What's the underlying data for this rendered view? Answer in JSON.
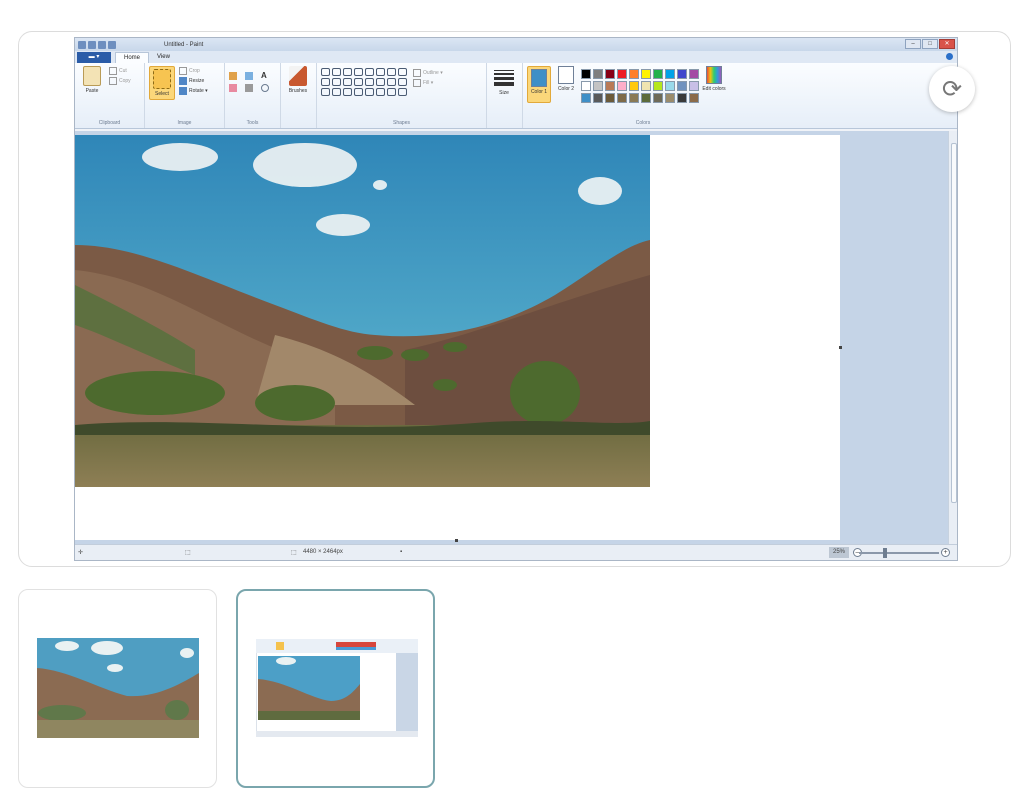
{
  "viewer": {
    "refresh_icon": "refresh-icon",
    "refresh_glyph": "⟳"
  },
  "paint": {
    "window_title": "Untitled - Paint",
    "file_button": "▬ ▾",
    "tabs": [
      {
        "label": "Home",
        "active": true
      },
      {
        "label": "View",
        "active": false
      }
    ],
    "window_controls": {
      "minimize": "–",
      "maximize": "□",
      "close": "✕"
    },
    "ribbon": {
      "clipboard": {
        "label": "Clipboard",
        "paste": "Paste",
        "cut": "Cut",
        "copy": "Copy"
      },
      "image": {
        "label": "Image",
        "select": "Select",
        "crop": "Crop",
        "resize": "Resize",
        "rotate": "Rotate ▾"
      },
      "tools": {
        "label": "Tools"
      },
      "brushes": {
        "label": "Brushes"
      },
      "shapes": {
        "label": "Shapes",
        "outline": "Outline ▾",
        "fill": "Fill ▾"
      },
      "size": {
        "label": "Size"
      },
      "colors": {
        "label": "Colors",
        "color1": "Color 1",
        "color2": "Color 2",
        "edit_colors": "Edit colors",
        "color1_value": "#3e8fc7",
        "color2_value": "#ffffff",
        "palette": [
          "#000000",
          "#7f7f7f",
          "#880015",
          "#ed1c24",
          "#ff7f27",
          "#fff200",
          "#22b14c",
          "#00a2e8",
          "#3f48cc",
          "#a349a4",
          "#ffffff",
          "#c3c3c3",
          "#b97a57",
          "#ffaec9",
          "#ffc90e",
          "#efe4b0",
          "#b5e61d",
          "#99d9ea",
          "#7092be",
          "#c8bfe7",
          "#3e8fc7",
          "#5a5a5a",
          "#6b5a3a",
          "#7d6a48",
          "#8a7a55",
          "#5c6b3c",
          "#6e6a58",
          "#9a8b6c",
          "#3a3a3a",
          "#8b6b4a"
        ]
      }
    },
    "status": {
      "canvas_size": "4480 × 2464px",
      "zoom": "25%",
      "zoom_minus": "–",
      "zoom_plus": "+"
    }
  },
  "thumbnails": [
    {
      "label": "landscape painting",
      "selected": false
    },
    {
      "label": "paint screenshot",
      "selected": true
    }
  ]
}
